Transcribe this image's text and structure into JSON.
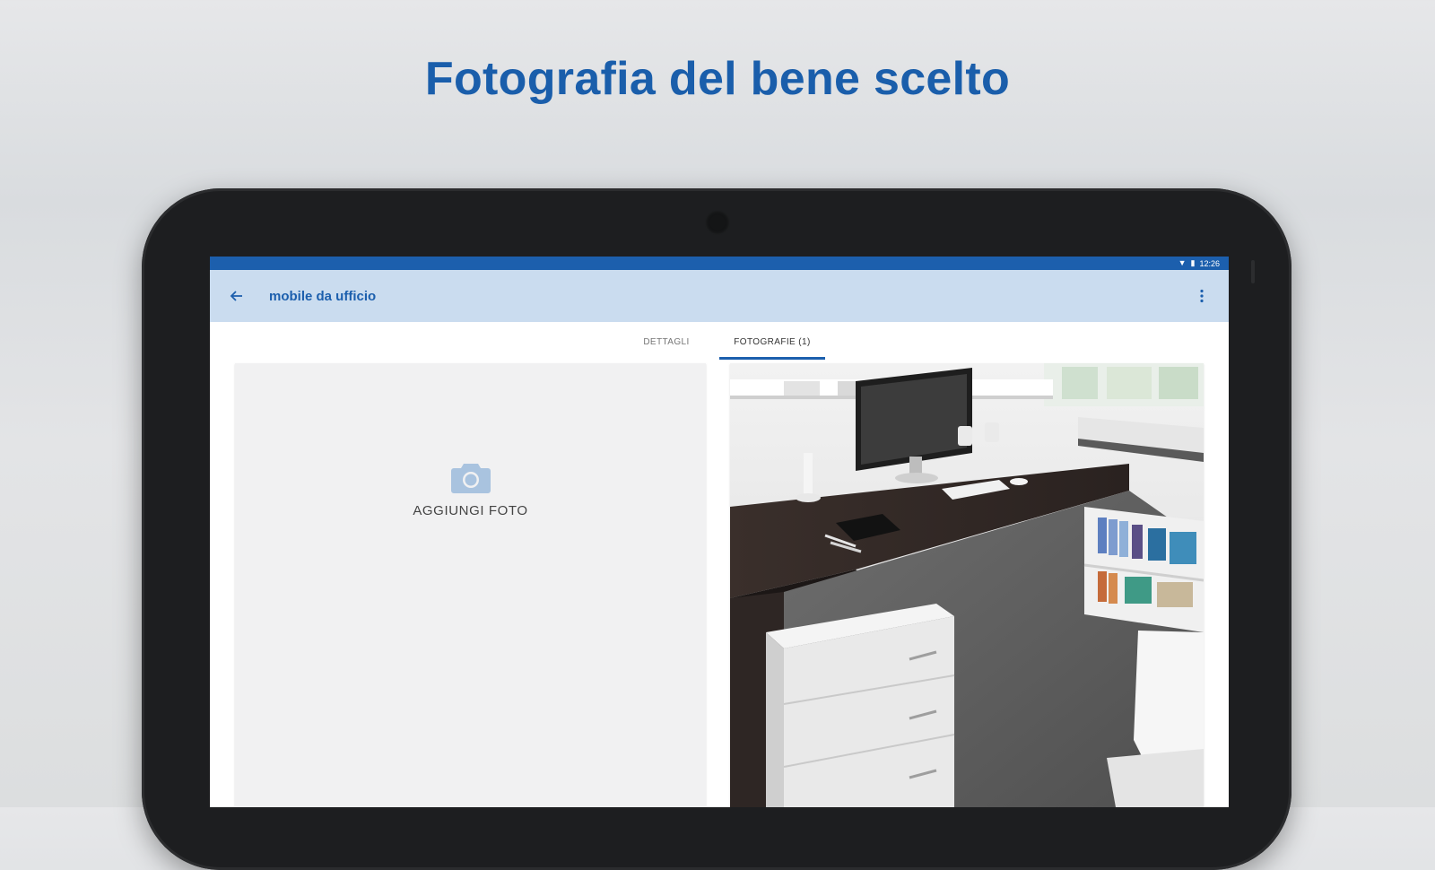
{
  "headline": "Fotografia del bene scelto",
  "colors": {
    "brand": "#1c5fad",
    "appbar": "#cadcef",
    "headline": "#1a5eab"
  },
  "statusbar": {
    "icons": [
      "wifi-icon",
      "battery-icon"
    ],
    "time": "12:26"
  },
  "appbar": {
    "title": "mobile da ufficio",
    "back_icon": "arrow-left-icon",
    "menu_icon": "more-vertical-icon"
  },
  "tabs": [
    {
      "label": "DETTAGLI",
      "active": false
    },
    {
      "label": "FOTOGRAFIE (1)",
      "active": true
    }
  ],
  "add_photo": {
    "label": "AGGIUNGI FOTO",
    "icon": "camera-icon"
  },
  "photo": {
    "subject": "office desk with computer",
    "icon": "photo-thumbnail"
  }
}
